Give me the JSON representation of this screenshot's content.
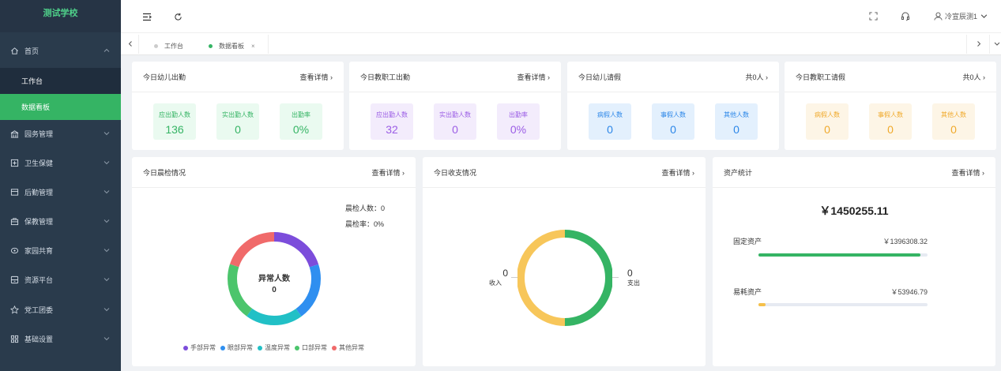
{
  "app": {
    "logo": "测试学校"
  },
  "sidebar": {
    "items": [
      {
        "label": "首页",
        "icon": "home-icon"
      },
      {
        "label": "工作台"
      },
      {
        "label": "数据看板"
      },
      {
        "label": "园务管理",
        "icon": "building-icon"
      },
      {
        "label": "卫生保健",
        "icon": "health-icon"
      },
      {
        "label": "后勤管理",
        "icon": "box-icon"
      },
      {
        "label": "保教管理",
        "icon": "briefcase-icon"
      },
      {
        "label": "家园共育",
        "icon": "location-icon"
      },
      {
        "label": "资源平台",
        "icon": "archive-icon"
      },
      {
        "label": "党工团委",
        "icon": "star-icon"
      },
      {
        "label": "基础设置",
        "icon": "grid-icon"
      }
    ]
  },
  "header": {
    "user": "冷宣辰测1"
  },
  "tabs": [
    {
      "label": "工作台"
    },
    {
      "label": "数据看板"
    }
  ],
  "colors": {
    "green": "#35b464",
    "accent_purple": "#8b5cf6"
  },
  "cards": {
    "child_att": {
      "title": "今日幼儿出勤",
      "link": "查看详情",
      "stats": [
        {
          "label": "应出勤人数",
          "value": "136"
        },
        {
          "label": "实出勤人数",
          "value": "0"
        },
        {
          "label": "出勤率",
          "value": "0%"
        }
      ]
    },
    "staff_att": {
      "title": "今日教职工出勤",
      "link": "查看详情",
      "stats": [
        {
          "label": "应出勤人数",
          "value": "32"
        },
        {
          "label": "实出勤人数",
          "value": "0"
        },
        {
          "label": "出勤率",
          "value": "0%"
        }
      ]
    },
    "child_leave": {
      "title": "今日幼儿请假",
      "link": "共0人",
      "stats": [
        {
          "label": "病假人数",
          "value": "0"
        },
        {
          "label": "事假人数",
          "value": "0"
        },
        {
          "label": "其他人数",
          "value": "0"
        }
      ]
    },
    "staff_leave": {
      "title": "今日教职工请假",
      "link": "共0人",
      "stats": [
        {
          "label": "病假人数",
          "value": "0"
        },
        {
          "label": "事假人数",
          "value": "0"
        },
        {
          "label": "其他人数",
          "value": "0"
        }
      ]
    },
    "morning": {
      "title": "今日晨检情况",
      "link": "查看详情",
      "count_label": "晨检人数：0",
      "rate_label": "晨检率：0%",
      "center_label": "异常人数",
      "center_value": "0",
      "legend": [
        {
          "label": "手部异常",
          "color": "#7c4ddb"
        },
        {
          "label": "眼部异常",
          "color": "#2f8ff0"
        },
        {
          "label": "温度异常",
          "color": "#21c0c6"
        },
        {
          "label": "口部异常",
          "color": "#4cc56c"
        },
        {
          "label": "其他异常",
          "color": "#f06a6a"
        }
      ]
    },
    "finance": {
      "title": "今日收支情况",
      "link": "查看详情",
      "income_value": "0",
      "income_label": "收入",
      "expense_value": "0",
      "expense_label": "支出"
    },
    "assets": {
      "title": "资产统计",
      "link": "查看详情",
      "total": "￥1450255.11",
      "rows": [
        {
          "label": "固定资产",
          "value": "￥1396308.32",
          "progress": 0.96,
          "color": "#35b464"
        },
        {
          "label": "易耗资产",
          "value": "￥53946.79",
          "progress": 0.04,
          "color": "#f5c04a"
        }
      ]
    }
  }
}
